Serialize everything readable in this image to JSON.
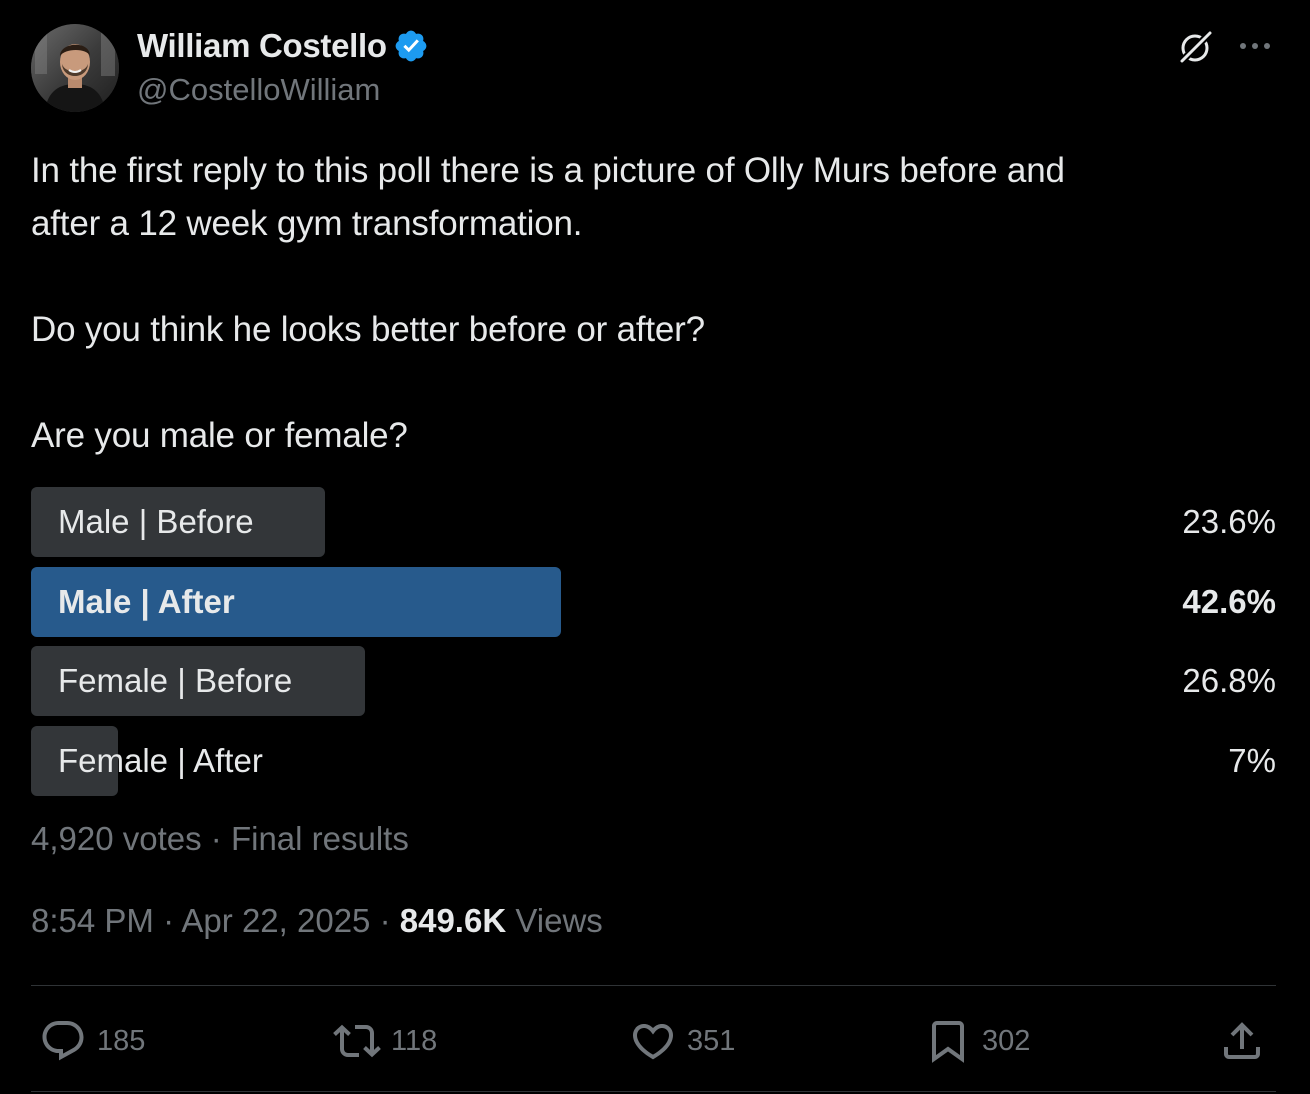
{
  "author": {
    "display_name": "William Costello",
    "handle": "@CostelloWilliam",
    "verified": true,
    "verified_color": "#1d9bf0"
  },
  "header_icons": {
    "grok": "grok-icon",
    "more": "more-icon"
  },
  "tweet": {
    "paragraphs": [
      "In the first reply to this poll there is a picture of Olly Murs before and",
      "after a 12 week gym transformation.",
      "Do you think he looks better before or after?",
      "Are you male or female?"
    ]
  },
  "poll": {
    "options": [
      {
        "label": "Male | Before",
        "percent_text": "23.6%",
        "percent": 23.6,
        "winner": false
      },
      {
        "label": "Male | After",
        "percent_text": "42.6%",
        "percent": 42.6,
        "winner": true
      },
      {
        "label": "Female | Before",
        "percent_text": "26.8%",
        "percent": 26.8,
        "winner": false
      },
      {
        "label": "Female | After",
        "percent_text": "7%",
        "percent": 7,
        "winner": false
      }
    ],
    "meta": "4,920 votes · Final results",
    "winner_color": "#275a8c",
    "bar_color": "#333639"
  },
  "meta": {
    "time": "8:54 PM",
    "date": "Apr 22, 2025",
    "views_count": "849.6K",
    "views_label": "Views"
  },
  "actions": {
    "reply": {
      "icon": "reply-icon",
      "count": "185"
    },
    "repost": {
      "icon": "repost-icon",
      "count": "118"
    },
    "like": {
      "icon": "heart-icon",
      "count": "351"
    },
    "bookmark": {
      "icon": "bookmark-icon",
      "count": "302"
    },
    "share": {
      "icon": "share-icon"
    }
  },
  "colors": {
    "background": "#000000",
    "text_primary": "#e7e9ea",
    "text_secondary": "#71767b",
    "divider": "#2f3336"
  }
}
